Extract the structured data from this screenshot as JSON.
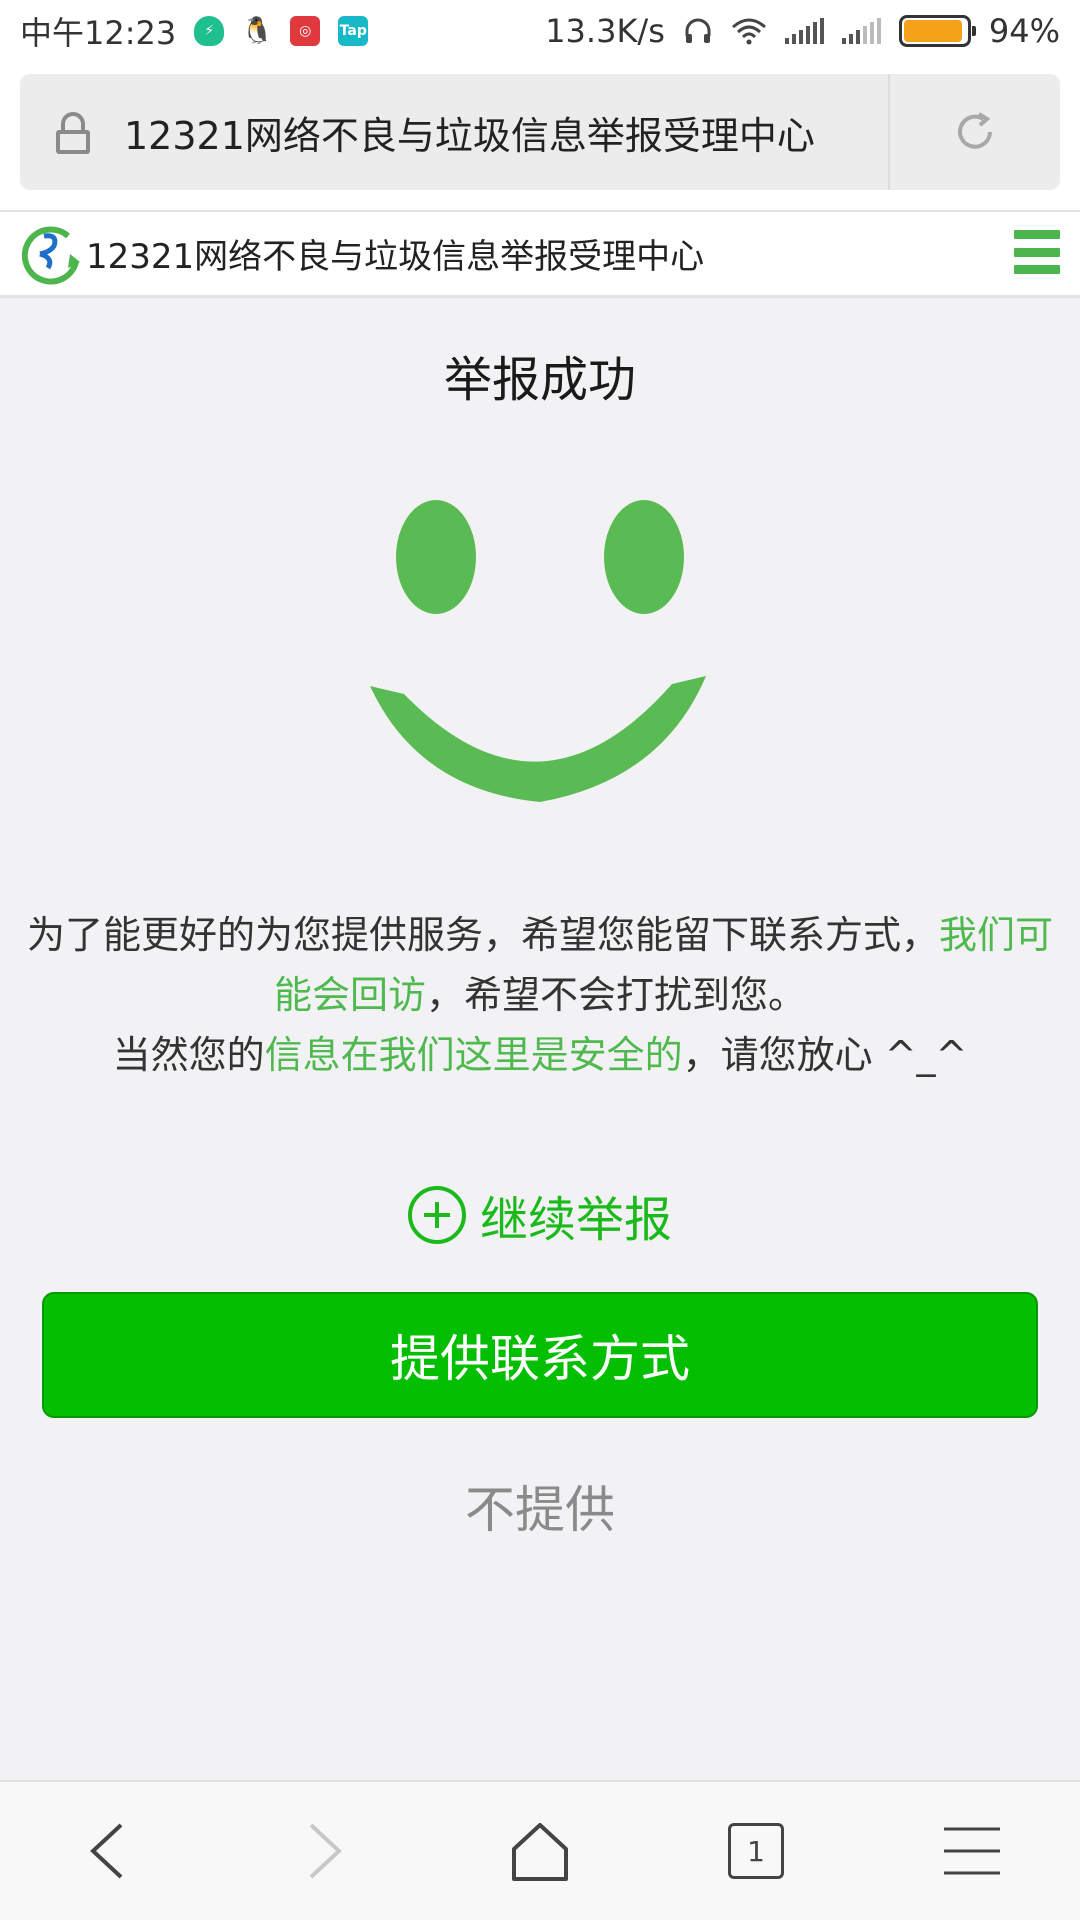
{
  "status_bar": {
    "time": "中午12:23",
    "net_speed": "13.3K/s",
    "battery_percent": "94%",
    "battery_level": 0.94,
    "app_icons": [
      "shield-icon",
      "qq-icon",
      "netease-icon",
      "taptap-icon"
    ],
    "tap_label": "Tap"
  },
  "browser": {
    "address_text": "12321网络不良与垃圾信息举报受理中心",
    "tabs_count": "1"
  },
  "site": {
    "title": "12321网络不良与垃圾信息举报受理中心",
    "accent_color": "#4cb64c"
  },
  "main": {
    "heading": "举报成功",
    "message": {
      "line1_a": "为了能更好的为您提供服务，希望您能留下联系方式，",
      "line1_b": "我们可",
      "line2_a": "能会回访",
      "line2_b": "，希望不会打扰到您。",
      "line3_a": "当然您的",
      "line3_b": "信息在我们这里是安全的",
      "line3_c": "，请您放心 ^_^"
    },
    "continue_label": "继续举报",
    "provide_contact_label": "提供联系方式",
    "decline_label": "不提供"
  },
  "colors": {
    "primary_button": "#04be02",
    "smiley": "#5abb55",
    "link_green": "#1cb91c"
  }
}
